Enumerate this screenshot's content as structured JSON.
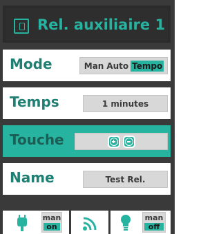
{
  "header": {
    "title": "Rel. auxiliaire 1",
    "icon": "relay-icon"
  },
  "rows": {
    "mode": {
      "label": "Mode",
      "options": [
        "Man",
        "Auto",
        "Tempo"
      ],
      "selected": "Tempo"
    },
    "temps": {
      "label": "Temps",
      "value": "1 minutes"
    },
    "touche": {
      "label": "Touche",
      "buttons": [
        "plus-icon",
        "minus-icon"
      ]
    },
    "name": {
      "label": "Name",
      "value": "Test Rel."
    }
  },
  "footer": {
    "left": {
      "icon": "plug-icon",
      "line1": "man",
      "line2": "on"
    },
    "middle": {
      "icon": "wifi-icon"
    },
    "right": {
      "icon": "bulb-icon",
      "line1": "man",
      "line2": "off"
    }
  },
  "colors": {
    "accent": "#26b3a0",
    "dark": "#3a3a3a",
    "label": "#1f7f72",
    "box": "#d8d8d8"
  }
}
